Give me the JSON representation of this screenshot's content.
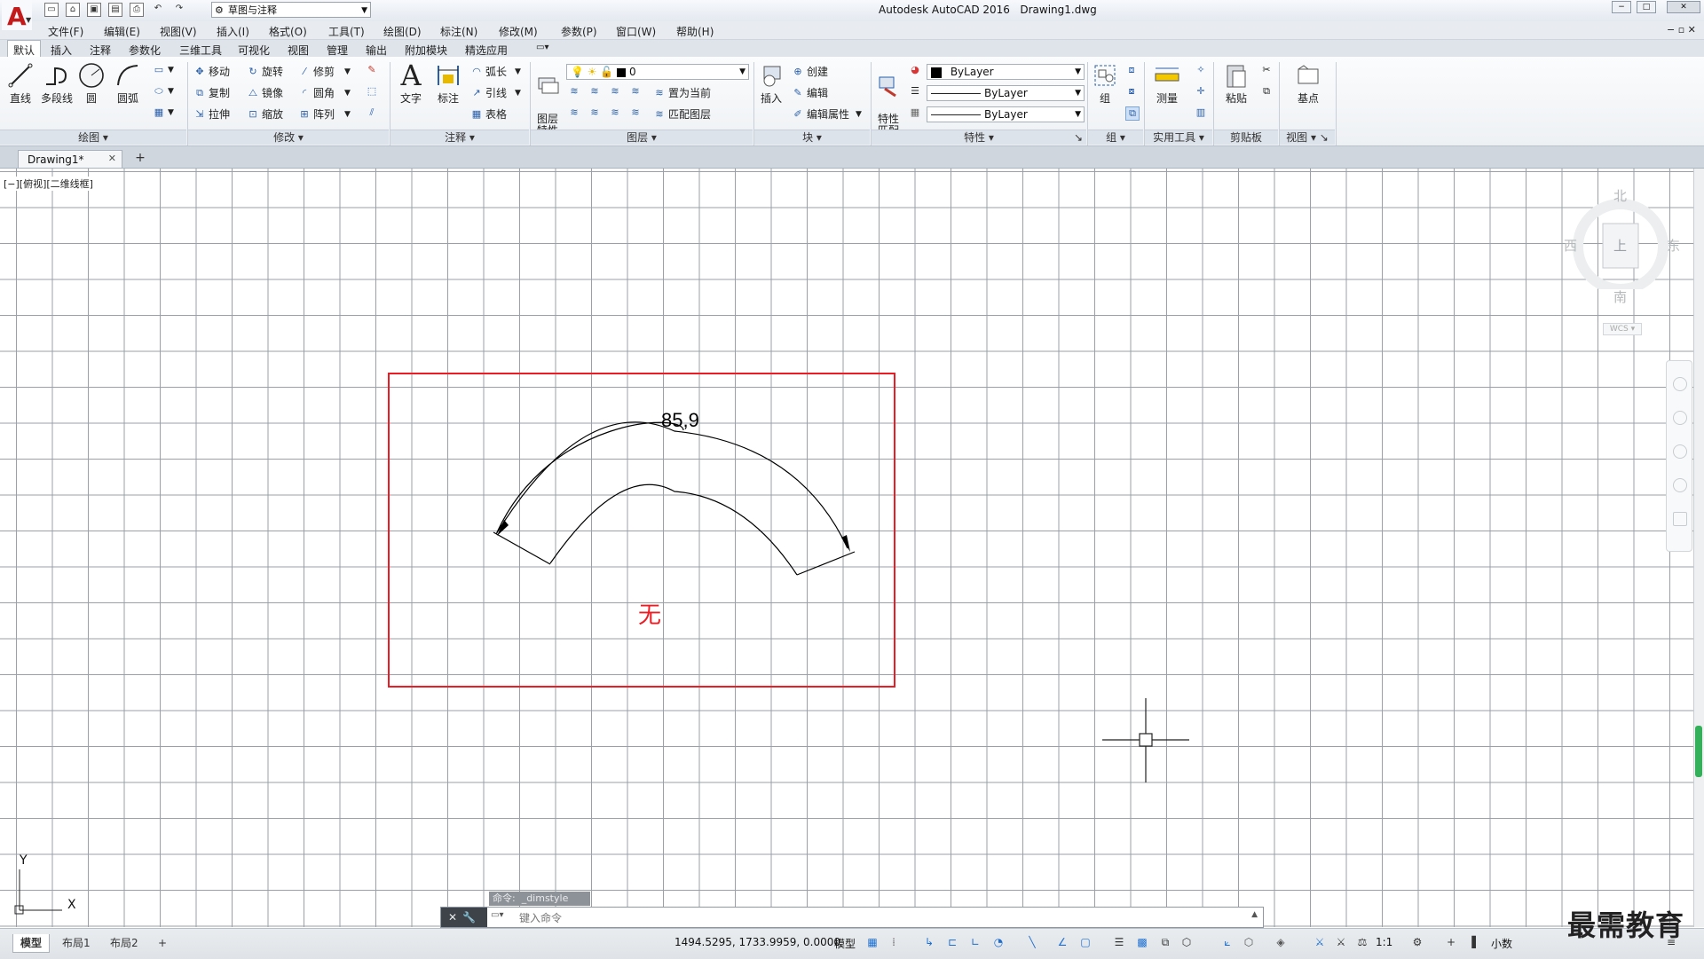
{
  "window": {
    "title": "Autodesk AutoCAD 2016",
    "document": "Drawing1.dwg",
    "workspace": "草图与注释"
  },
  "menu": [
    "文件(F)",
    "编辑(E)",
    "视图(V)",
    "插入(I)",
    "格式(O)",
    "工具(T)",
    "绘图(D)",
    "标注(N)",
    "修改(M)",
    "参数(P)",
    "窗口(W)",
    "帮助(H)"
  ],
  "ribbon_tabs": [
    "默认",
    "插入",
    "注释",
    "参数化",
    "三维工具",
    "可视化",
    "视图",
    "管理",
    "输出",
    "附加模块",
    "精选应用"
  ],
  "ribbon": {
    "draw": {
      "title": "绘图",
      "line": "直线",
      "polyline": "多段线",
      "circle": "圆",
      "arc": "圆弧"
    },
    "modify": {
      "title": "修改",
      "move": "移动",
      "rotate": "旋转",
      "trim": "修剪",
      "copy": "复制",
      "mirror": "镜像",
      "fillet": "圆角",
      "stretch": "拉伸",
      "scale": "缩放",
      "array": "阵列"
    },
    "annotation": {
      "title": "注释",
      "text": "文字",
      "dimension": "标注",
      "arclength": "弧长",
      "leader": "引线",
      "table": "表格"
    },
    "layers": {
      "title": "图层",
      "properties": "图层\n特性",
      "current_layer": "0",
      "set_current": "置为当前",
      "match": "匹配图层"
    },
    "block": {
      "title": "块",
      "insert": "插入",
      "create": "创建",
      "edit": "编辑",
      "edit_attr": "编辑属性"
    },
    "properties": {
      "title": "特性",
      "match": "特性\n匹配",
      "color": "ByLayer",
      "linetype": "ByLayer",
      "lineweight": "ByLayer"
    },
    "groups": {
      "title": "组",
      "group": "组"
    },
    "utilities": {
      "title": "实用工具",
      "measure": "测量"
    },
    "clipboard": {
      "title": "剪贴板",
      "paste": "粘贴"
    },
    "view": {
      "title": "视图",
      "base": "基点"
    }
  },
  "doc_tab": {
    "label": "Drawing1*"
  },
  "viewport_label": "[−][俯视][二维线框]",
  "viewcube": {
    "north": "北",
    "south": "南",
    "east": "东",
    "west": "西",
    "top": "上",
    "wcs": "WCS"
  },
  "drawing": {
    "dimension_text": "85,9",
    "note": "无"
  },
  "ucs": {
    "x": "X",
    "y": "Y"
  },
  "command": {
    "history": "命令:  _dimstyle",
    "placeholder": "键入命令"
  },
  "layout_tabs": [
    "模型",
    "布局1",
    "布局2"
  ],
  "status": {
    "coordinates": "1494.5295, 1733.9959, 0.0000",
    "model": "模型",
    "scale": "1:1",
    "units": "小数"
  },
  "watermark": "最需教育",
  "colors": {
    "accent_red": "#ed1c24",
    "grid": "#9aa0a6",
    "nav_green": "#34b05a"
  }
}
